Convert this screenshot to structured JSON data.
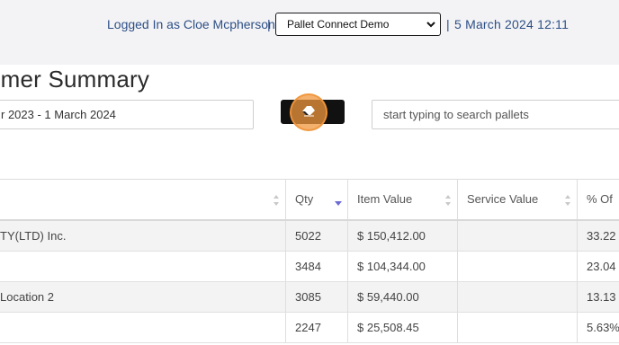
{
  "header": {
    "logged_in_text": "Logged In as Cloe Mcpherson",
    "separator": "|",
    "account_select": {
      "selected": "Pallet Connect Demo"
    },
    "datetime": "5 March 2024 12:11"
  },
  "page": {
    "title": "omer Summary",
    "date_range": "r 2023 - 1 March 2024",
    "search_placeholder": "start typing to search pallets"
  },
  "table": {
    "columns": [
      "",
      "Qty",
      "Item Value",
      "Service Value",
      "% Of"
    ],
    "sort": {
      "column": "Qty",
      "direction": "desc"
    },
    "rows": [
      {
        "name": "TY(LTD) Inc.",
        "qty": "5022",
        "item_value": "$ 150,412.00",
        "service_value": "",
        "pct": "33.22"
      },
      {
        "name": "",
        "qty": "3484",
        "item_value": "$ 104,344.00",
        "service_value": "",
        "pct": "23.04"
      },
      {
        "name": "Location 2",
        "qty": "3085",
        "item_value": "$ 59,440.00",
        "service_value": "",
        "pct": "13.13"
      },
      {
        "name": "",
        "qty": "2247",
        "item_value": "$ 25,508.45",
        "service_value": "",
        "pct": "5.63%"
      }
    ]
  },
  "colors": {
    "link_blue": "#2d4f86",
    "sort_active": "#6b6bd6",
    "click_highlight": "#f0963c"
  },
  "icons": {
    "clear_button": "eraser-icon",
    "select": "chevron-down-icon",
    "sort": "sort-icon"
  }
}
